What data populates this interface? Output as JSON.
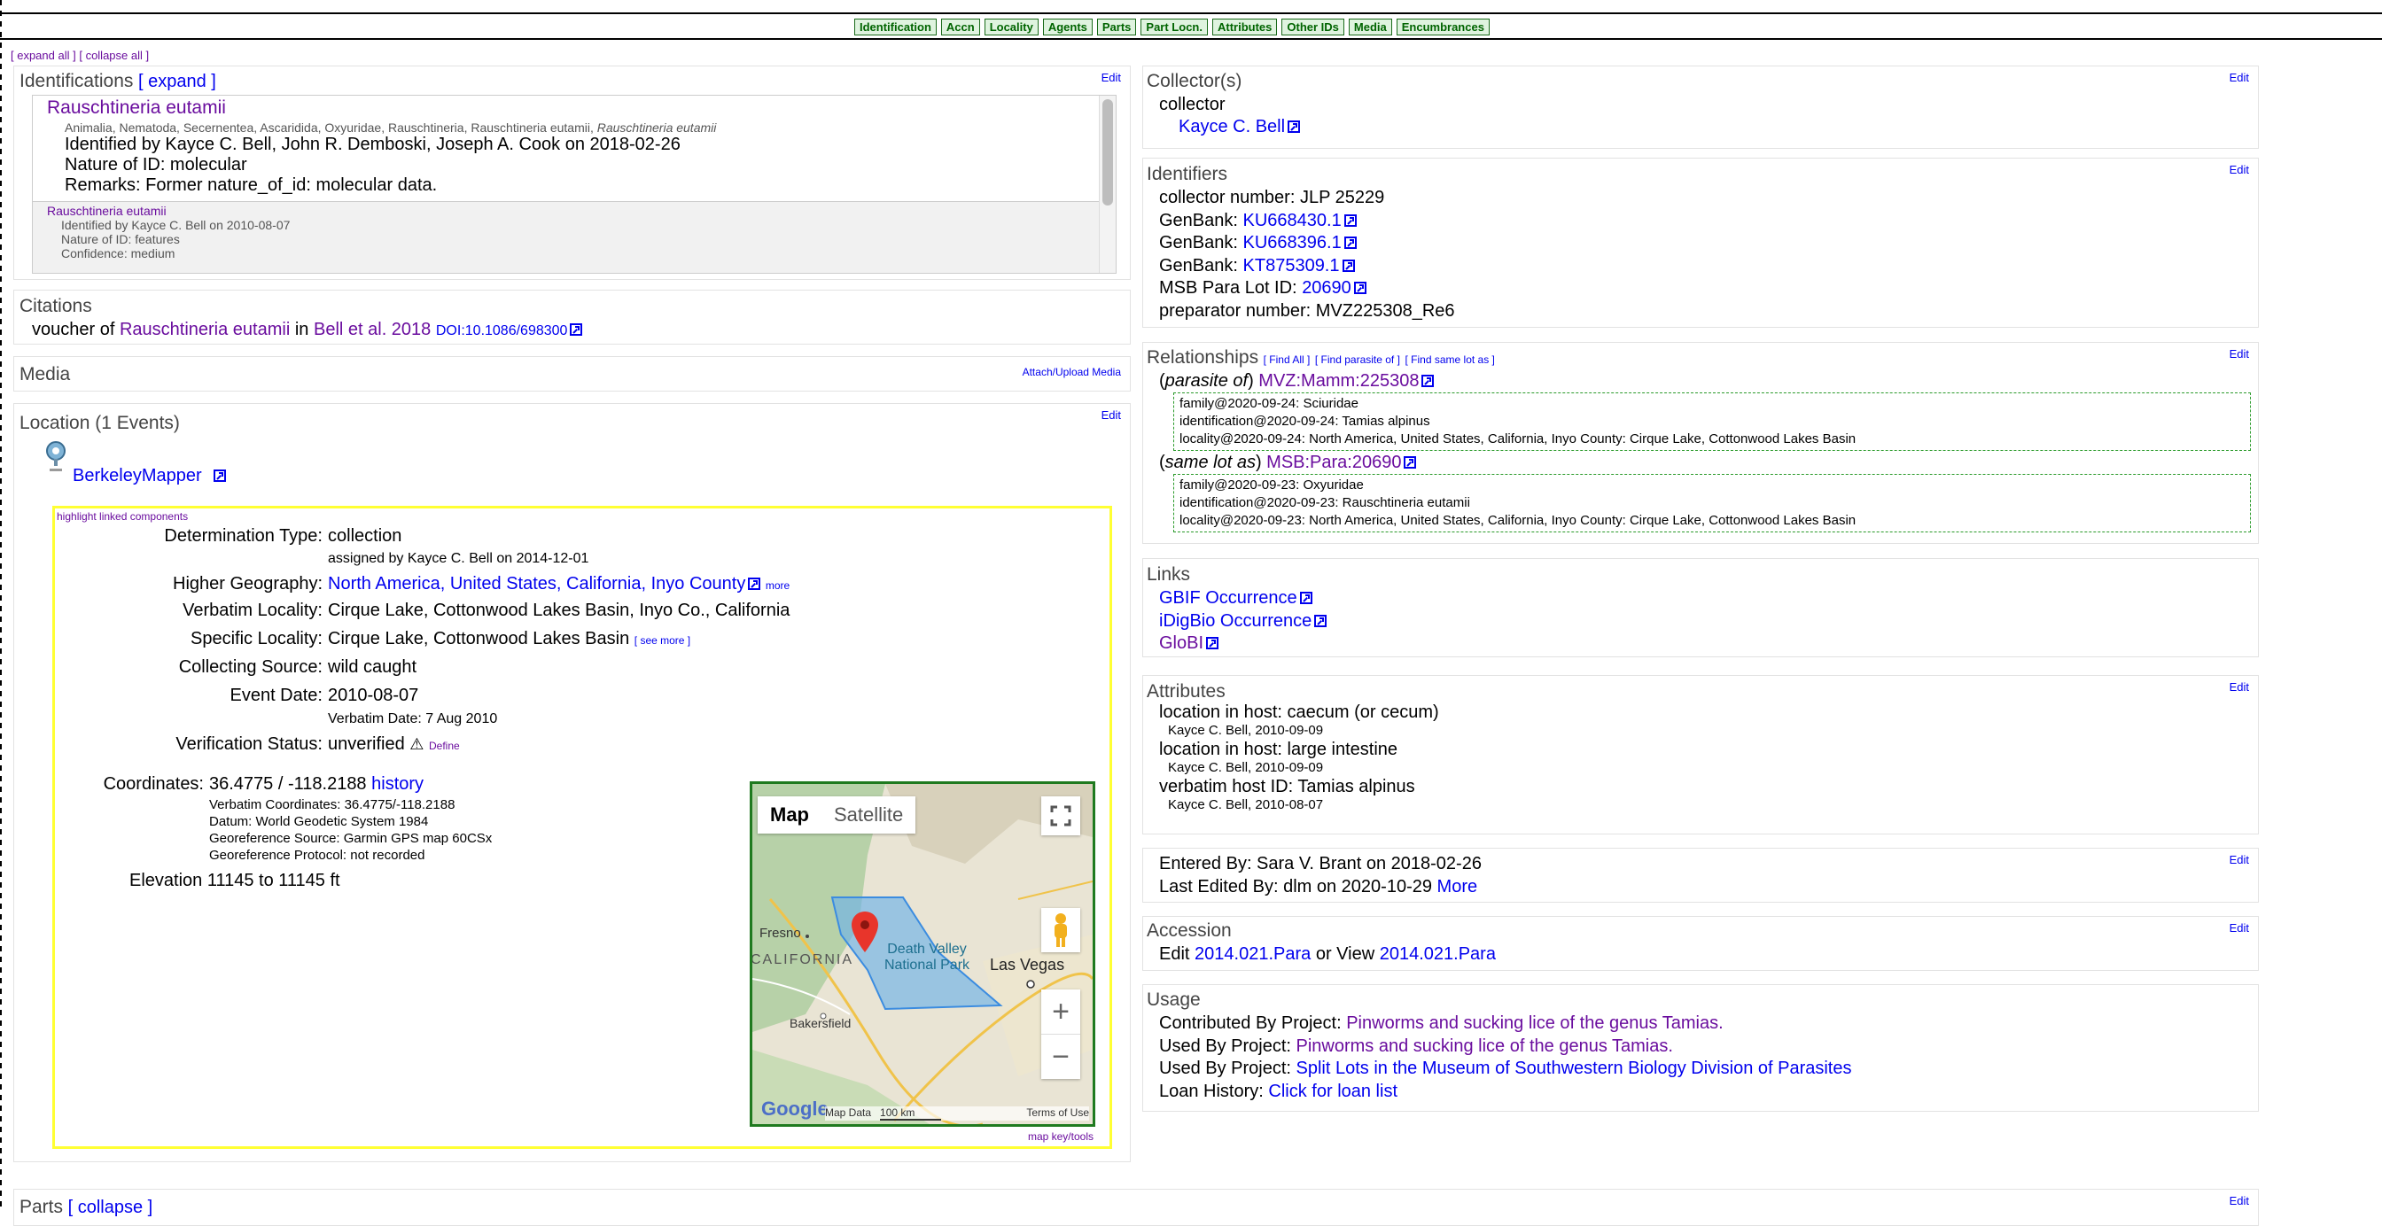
{
  "nav": {
    "tabs": [
      "Identification",
      "Accn",
      "Locality",
      "Agents",
      "Parts",
      "Part Locn.",
      "Attributes",
      "Other IDs",
      "Media",
      "Encumbrances"
    ],
    "expand_all": "[ expand all ]",
    "collapse_all": "[ collapse all ]"
  },
  "common": {
    "edit": "Edit"
  },
  "identifications": {
    "title": "Identifications",
    "expand": "[ expand ]",
    "primary": {
      "name": "Rauschtineria eutamii",
      "taxonomy": "Animalia, Nematoda, Secernentea, Ascaridida, Oxyuridae, Rauschtineria, Rauschtineria eutamii,",
      "taxonomy_italic": "Rauschtineria eutamii",
      "identified_by": "Identified by Kayce C. Bell, John R. Demboski, Joseph A. Cook on 2018-02-26",
      "nature": "Nature of ID: molecular",
      "remarks": "Remarks: Former nature_of_id: molecular data."
    },
    "secondary": {
      "name": "Rauschtineria eutamii",
      "identified_by": "Identified by Kayce C. Bell on 2010-08-07",
      "nature": "Nature of ID: features",
      "confidence": "Confidence: medium"
    }
  },
  "citations": {
    "title": "Citations",
    "voucher_of": "voucher of",
    "taxon": "Rauschtineria eutamii",
    "in": "in",
    "pub": "Bell et al. 2018",
    "doi": "DOI:10.1086/698300"
  },
  "media": {
    "title": "Media",
    "attach": "Attach/Upload Media"
  },
  "location": {
    "title": "Location (1 Events)",
    "mapper": "BerkeleyMapper",
    "highlight": "highlight linked components",
    "determination_type_label": "Determination Type:",
    "determination_type": "collection",
    "assigned_by": "assigned by Kayce C. Bell on 2014-12-01",
    "higher_geo_label": "Higher Geography:",
    "higher_geo": "North America, United States, California, Inyo County",
    "more": "more",
    "verbatim_locality_label": "Verbatim Locality:",
    "verbatim_locality": "Cirque Lake, Cottonwood Lakes Basin, Inyo Co., California",
    "specific_locality_label": "Specific Locality:",
    "specific_locality": "Cirque Lake, Cottonwood Lakes Basin",
    "see_more": "[ see more ]",
    "collecting_source_label": "Collecting Source:",
    "collecting_source": "wild caught",
    "event_date_label": "Event Date:",
    "event_date": "2010-08-07",
    "verbatim_date": "Verbatim Date: 7 Aug 2010",
    "verification_label": "Verification Status:",
    "verification": "unverified",
    "define": "Define",
    "coordinates_label": "Coordinates:",
    "coordinates": "36.4775 / -118.2188",
    "history": "history",
    "verbatim_coords": "Verbatim Coordinates: 36.4775/-118.2188",
    "datum": "Datum: World Geodetic System 1984",
    "georef_source": "Georeference Source: Garmin GPS map 60CSx",
    "georef_protocol": "Georeference Protocol: not recorded",
    "elevation": "Elevation 11145 to 11145 ft",
    "map_key": "map key/tools"
  },
  "map": {
    "tab_map": "Map",
    "tab_satellite": "Satellite",
    "fresno": "Fresno",
    "california": "CALIFORNIA",
    "park": "Death Valley National Park",
    "las_vegas": "Las Vegas",
    "bakersfield": "Bakersfield",
    "google": "Google",
    "map_data": "Map Data",
    "scale": "100 km",
    "terms": "Terms of Use",
    "zoom_in": "+",
    "zoom_out": "−"
  },
  "collectors": {
    "title": "Collector(s)",
    "role": "collector",
    "name": "Kayce C. Bell"
  },
  "identifiers": {
    "title": "Identifiers",
    "collector_number": "collector number: JLP 25229",
    "genbank_label": "GenBank:",
    "genbank": [
      "KU668430.1",
      "KU668396.1",
      "KT875309.1"
    ],
    "msb_label": "MSB Para Lot ID:",
    "msb_value": "20690",
    "preparator": "preparator number: MVZ225308_Re6"
  },
  "relationships": {
    "title": "Relationships",
    "find_all": "[ Find All ]",
    "find_parasite": "[ Find parasite of ]",
    "find_same_lot": "[ Find same lot as ]",
    "items": [
      {
        "rel": "parasite of",
        "target": "MVZ:Mamm:225308",
        "lines": [
          "family@2020-09-24: Sciuridae",
          "identification@2020-09-24: Tamias alpinus",
          "locality@2020-09-24: North America, United States, California, Inyo County: Cirque Lake, Cottonwood Lakes Basin"
        ]
      },
      {
        "rel": "same lot as",
        "target": "MSB:Para:20690",
        "lines": [
          "family@2020-09-23: Oxyuridae",
          "identification@2020-09-23: Rauschtineria eutamii",
          "locality@2020-09-23: North America, United States, California, Inyo County: Cirque Lake, Cottonwood Lakes Basin"
        ]
      }
    ]
  },
  "links": {
    "title": "Links",
    "gbif": "GBIF Occurrence",
    "idigbio": "iDigBio Occurrence",
    "globi": "GloBI"
  },
  "attributes": {
    "title": "Attributes",
    "items": [
      {
        "text": "location in host: caecum (or cecum)",
        "by": "Kayce C. Bell, 2010-09-09"
      },
      {
        "text": "location in host: large intestine",
        "by": "Kayce C. Bell, 2010-09-09"
      },
      {
        "text": "verbatim host ID: Tamias alpinus",
        "by": "Kayce C. Bell, 2010-08-07"
      }
    ]
  },
  "entered": {
    "entered_by": "Entered By: Sara V. Brant on 2018-02-26",
    "last_edited": "Last Edited By: dlm on 2020-10-29",
    "more": "More"
  },
  "accession": {
    "title": "Accession",
    "edit_label": "Edit",
    "value": "2014.021.Para",
    "or_view": "or View",
    "view_value": "2014.021.Para"
  },
  "usage": {
    "title": "Usage",
    "contributed_label": "Contributed By Project:",
    "contributed": "Pinworms and sucking lice of the genus Tamias.",
    "used_label": "Used By Project:",
    "used1": "Pinworms and sucking lice of the genus Tamias.",
    "used2": "Split Lots in the Museum of Southwestern Biology Division of Parasites",
    "loan_label": "Loan History:",
    "loan": "Click for loan list"
  },
  "parts": {
    "title": "Parts",
    "collapse": "[ collapse ]"
  }
}
